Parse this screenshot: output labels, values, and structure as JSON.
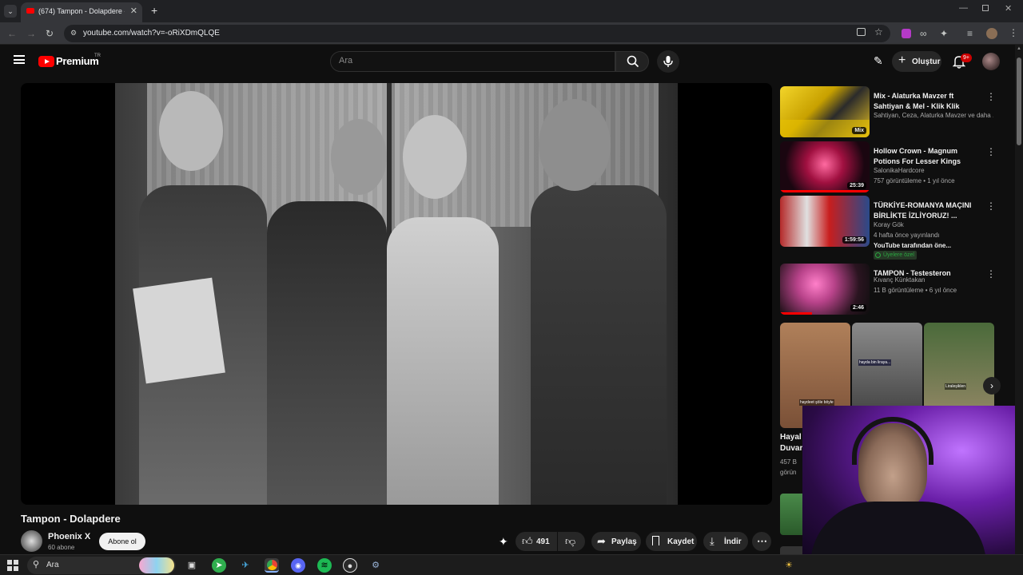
{
  "browser": {
    "tab_title": "(674) Tampon - Dolapdere - YouTube",
    "url": "youtube.com/watch?v=-oRiXDmQLQE",
    "new_tab_icon": "plus-icon"
  },
  "header": {
    "logo_text": "Premium",
    "logo_region": "TR",
    "search_placeholder": "Ara",
    "create_label": "Oluştur",
    "notification_count": "9+"
  },
  "video": {
    "title": "Tampon - Dolapdere",
    "channel_name": "Phoenix X",
    "subscribers": "60 abone",
    "subscribe_label": "Abone ol",
    "like_count": "491",
    "share_label": "Paylaş",
    "save_label": "Kaydet",
    "download_label": "İndir"
  },
  "recommendations": [
    {
      "title": "Mix - Alaturka Mavzer ft Sahtiyan & Mel - Klik Klik",
      "meta1": "Sahtiyan, Ceza, Alaturka Mavzer ve daha ...",
      "meta2": "",
      "badge": "Mix"
    },
    {
      "title": "Hollow Crown - Magnum Potions For Lesser Kings",
      "meta1": "SalonikaHardcore",
      "meta2": "757 görüntüleme • 1 yıl önce",
      "badge": "25:39"
    },
    {
      "title": "TÜRKİYE-ROMANYA MAÇINI BİRLİKTE İZLİYORUZ! ...",
      "meta1": "Koray Gök",
      "meta2": "4 hafta önce yayınlandı",
      "meta3": "YouTube tarafından öne...",
      "member_badge": "Üyelere özel",
      "badge": "1:59:56"
    },
    {
      "title": "TAMPON - Testesteron",
      "meta1": "Kıvanç Künktakan",
      "meta2": "11 B görüntüleme • 6 yıl önce",
      "badge": "2:46"
    }
  ],
  "shorts": {
    "captions": [
      "haydeet şöle böyle",
      "hayda bin liraya...",
      "Liraleşiklen"
    ],
    "partial_title_1": "Hayal",
    "partial_title_2": "Duvar",
    "partial_views": "457 B",
    "partial_meta": "görün"
  },
  "taskbar": {
    "search_label": "Ara"
  },
  "colors": {
    "yt_red": "#ff0000",
    "member_green": "#2ba640",
    "webcam_purple": "#9b3df0"
  }
}
